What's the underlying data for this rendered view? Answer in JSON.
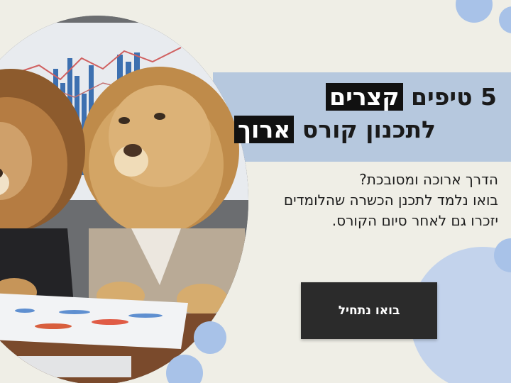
{
  "headline": {
    "line1_prefix": "5 טיפים",
    "line1_highlight": "קצרים",
    "line2_prefix": "לתכנון קורס",
    "line2_highlight": "ארוך"
  },
  "body_lines": [
    "הדרך ארוכה ומסובכת?",
    "בואו נלמד לתכנן הכשרה שהלומדים",
    "יזכרו גם לאחר סיום הקורס."
  ],
  "cta": {
    "label": "בואו נתחיל"
  },
  "colors": {
    "background": "#efeee6",
    "band": "#b6c8de",
    "highlight": "#111111",
    "button": "#2b2b2b",
    "dot_blue": "#a8c2e8"
  },
  "image": {
    "subject": "two-lions-in-suits-at-meeting"
  }
}
